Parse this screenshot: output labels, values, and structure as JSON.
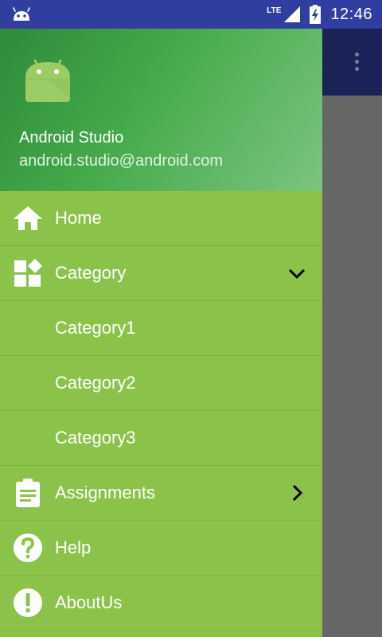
{
  "status_bar": {
    "network": "LTE",
    "time": "12:46",
    "icons": [
      "android-icon",
      "signal-icon",
      "battery-charging-icon"
    ]
  },
  "drawer": {
    "header": {
      "name": "Android Studio",
      "email": "android.studio@android.com"
    },
    "items": [
      {
        "label": "Home",
        "icon": "home-icon"
      },
      {
        "label": "Category",
        "icon": "widgets-icon",
        "trailing": "chevron-down-icon"
      },
      {
        "label": "Category1"
      },
      {
        "label": "Category2"
      },
      {
        "label": "Category3"
      },
      {
        "label": "Assignments",
        "icon": "clipboard-icon",
        "trailing": "chevron-right-icon"
      },
      {
        "label": "Help",
        "icon": "help-icon"
      },
      {
        "label": "AboutUs",
        "icon": "info-icon"
      }
    ]
  },
  "colors": {
    "status_bar": "#303f9f",
    "drawer_bg": "#8bc34a",
    "header_gradient_start": "#2e8b3a",
    "header_gradient_end": "#7cc47f",
    "scrim": "#666666",
    "toolbar": "#1a2357"
  }
}
